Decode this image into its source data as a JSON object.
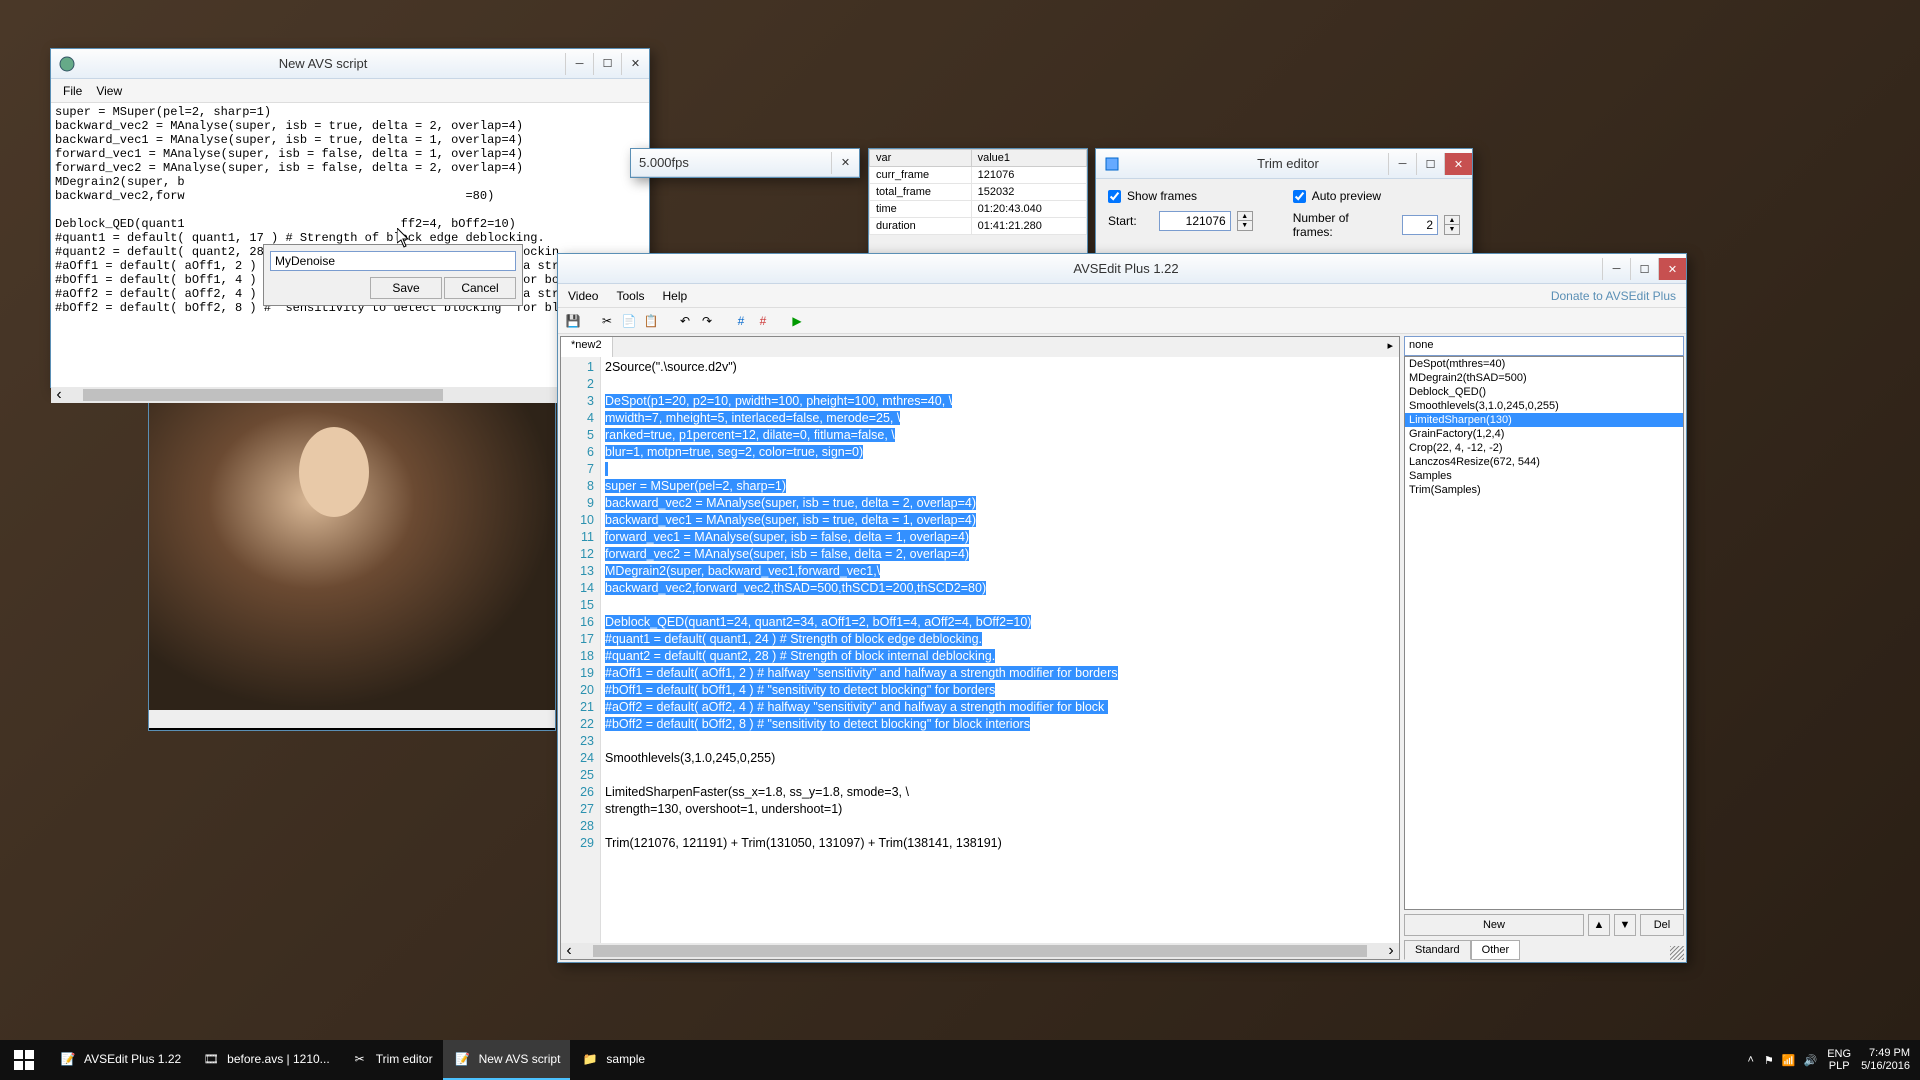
{
  "avs_window": {
    "title": "New AVS script",
    "menu": {
      "file": "File",
      "view": "View"
    },
    "code": "super = MSuper(pel=2, sharp=1)\nbackward_vec2 = MAnalyse(super, isb = true, delta = 2, overlap=4)\nbackward_vec1 = MAnalyse(super, isb = true, delta = 1, overlap=4)\nforward_vec1 = MAnalyse(super, isb = false, delta = 1, overlap=4)\nforward_vec2 = MAnalyse(super, isb = false, delta = 2, overlap=4)\nMDegrain2(super, b\nbackward_vec2,forw                                       =80)\n\nDeblock_QED(quant1                              ff2=4, bOff2=10)\n#quant1 = default( quant1, 17 ) # Strength of block edge deblocking.\n#quant2 = default( quant2, 28 ) # Strength of block internal deblockin\n#aOff1 = default( aOff1, 2 ) # halfway \"sensitivity\" and halfway a str\n#bOff1 = default( bOff1, 4 ) # \"sensitivity to detect blocking\" for bo\n#aOff2 = default( aOff2, 4 ) # halfway \"sensitivity\" and halfway a str\n#bOff2 = default( bOff2, 8 ) # \"sensitivity to detect blocking\" for bl"
  },
  "save_dlg": {
    "value": "MyDenoise",
    "save": "Save",
    "cancel": "Cancel"
  },
  "fps_window": {
    "title": "5.000fps"
  },
  "var_window": {
    "headers": {
      "var": "var",
      "val": "value1"
    },
    "rows": [
      {
        "k": "curr_frame",
        "v": "121076"
      },
      {
        "k": "total_frame",
        "v": "152032"
      },
      {
        "k": "time",
        "v": "01:20:43.040"
      },
      {
        "k": "duration",
        "v": "01:41:21.280"
      }
    ]
  },
  "trim_window": {
    "title": "Trim editor",
    "show_frames": "Show frames",
    "auto_preview": "Auto preview",
    "start_lbl": "Start:",
    "start_val": "121076",
    "nframes_lbl": "Number of frames:",
    "nframes_val": "2"
  },
  "main_window": {
    "title": "AVSEdit Plus 1.22",
    "menu": {
      "video": "Video",
      "tools": "Tools",
      "help": "Help"
    },
    "donate": "Donate to AVSEdit Plus",
    "tab": "*new2",
    "gutter": [
      "1",
      "2",
      "3",
      "4",
      "5",
      "6",
      "7",
      "8",
      "9",
      "10",
      "11",
      "12",
      "13",
      "14",
      "15",
      "16",
      "17",
      "18",
      "19",
      "20",
      "21",
      "22",
      "23",
      "24",
      "25",
      "26",
      "27",
      "28",
      "29"
    ],
    "lines": [
      {
        "t": "2Source(\".\\source.d2v\")",
        "s": false
      },
      {
        "t": "",
        "s": false
      },
      {
        "t": "DeSpot(p1=20, p2=10, pwidth=100, pheight=100, mthres=40, \\",
        "s": true
      },
      {
        "t": "mwidth=7, mheight=5, interlaced=false, merode=25, \\",
        "s": true
      },
      {
        "t": "ranked=true, p1percent=12, dilate=0, fitluma=false, \\",
        "s": true
      },
      {
        "t": "blur=1, motpn=true, seg=2, color=true, sign=0)",
        "s": true
      },
      {
        "t": "",
        "s": true
      },
      {
        "t": "super = MSuper(pel=2, sharp=1)",
        "s": true
      },
      {
        "t": "backward_vec2 = MAnalyse(super, isb = true, delta = 2, overlap=4)",
        "s": true
      },
      {
        "t": "backward_vec1 = MAnalyse(super, isb = true, delta = 1, overlap=4)",
        "s": true
      },
      {
        "t": "forward_vec1 = MAnalyse(super, isb = false, delta = 1, overlap=4)",
        "s": true
      },
      {
        "t": "forward_vec2 = MAnalyse(super, isb = false, delta = 2, overlap=4)",
        "s": true
      },
      {
        "t": "MDegrain2(super, backward_vec1,forward_vec1,\\",
        "s": true
      },
      {
        "t": "backward_vec2,forward_vec2,thSAD=500,thSCD1=200,thSCD2=80)",
        "s": true
      },
      {
        "t": "",
        "s": false
      },
      {
        "t": "Deblock_QED(quant1=24, quant2=34, aOff1=2, bOff1=4, aOff2=4, bOff2=10)",
        "s": true
      },
      {
        "t": "#quant1 = default( quant1, 24 ) # Strength of block edge deblocking.",
        "s": true
      },
      {
        "t": "#quant2 = default( quant2, 28 ) # Strength of block internal deblocking.",
        "s": true
      },
      {
        "t": "#aOff1 = default( aOff1, 2 ) # halfway \"sensitivity\" and halfway a strength modifier for borders",
        "s": true
      },
      {
        "t": "#bOff1 = default( bOff1, 4 ) # \"sensitivity to detect blocking\" for borders",
        "s": true
      },
      {
        "t": "#aOff2 = default( aOff2, 4 ) # halfway \"sensitivity\" and halfway a strength modifier for block ",
        "s": true
      },
      {
        "t": "#bOff2 = default( bOff2, 8 ) # \"sensitivity to detect blocking\" for block interiors",
        "s": true
      },
      {
        "t": "",
        "s": false
      },
      {
        "t": "Smoothlevels(3,1.0,245,0,255)",
        "s": false
      },
      {
        "t": "",
        "s": false
      },
      {
        "t": "LimitedSharpenFaster(ss_x=1.8, ss_y=1.8, smode=3, \\",
        "s": false
      },
      {
        "t": "strength=130, overshoot=1, undershoot=1)",
        "s": false
      },
      {
        "t": "",
        "s": false
      },
      {
        "t": "Trim(121076, 121191) + Trim(131050, 131097) + Trim(138141, 138191)",
        "s": false
      }
    ],
    "side": {
      "combo": "none",
      "items": [
        {
          "t": "DeSpot(mthres=40)",
          "s": false
        },
        {
          "t": "MDegrain2(thSAD=500)",
          "s": false
        },
        {
          "t": "Deblock_QED()",
          "s": false
        },
        {
          "t": "Smoothlevels(3,1.0,245,0,255)",
          "s": false
        },
        {
          "t": "LimitedSharpen(130)",
          "s": true
        },
        {
          "t": "GrainFactory(1,2,4)",
          "s": false
        },
        {
          "t": "Crop(22, 4, -12, -2)",
          "s": false
        },
        {
          "t": "Lanczos4Resize(672, 544)",
          "s": false
        },
        {
          "t": "Samples",
          "s": false
        },
        {
          "t": "Trim(Samples)",
          "s": false
        }
      ],
      "new": "New",
      "del": "Del",
      "standard": "Standard",
      "other": "Other"
    }
  },
  "taskbar": {
    "items": [
      {
        "label": "AVSEdit Plus 1.22"
      },
      {
        "label": "before.avs | 1210..."
      },
      {
        "label": "Trim editor"
      },
      {
        "label": "New AVS script"
      },
      {
        "label": "sample"
      }
    ],
    "lang1": "ENG",
    "lang2": "PLP",
    "time": "7:49 PM",
    "date": "5/16/2016"
  }
}
